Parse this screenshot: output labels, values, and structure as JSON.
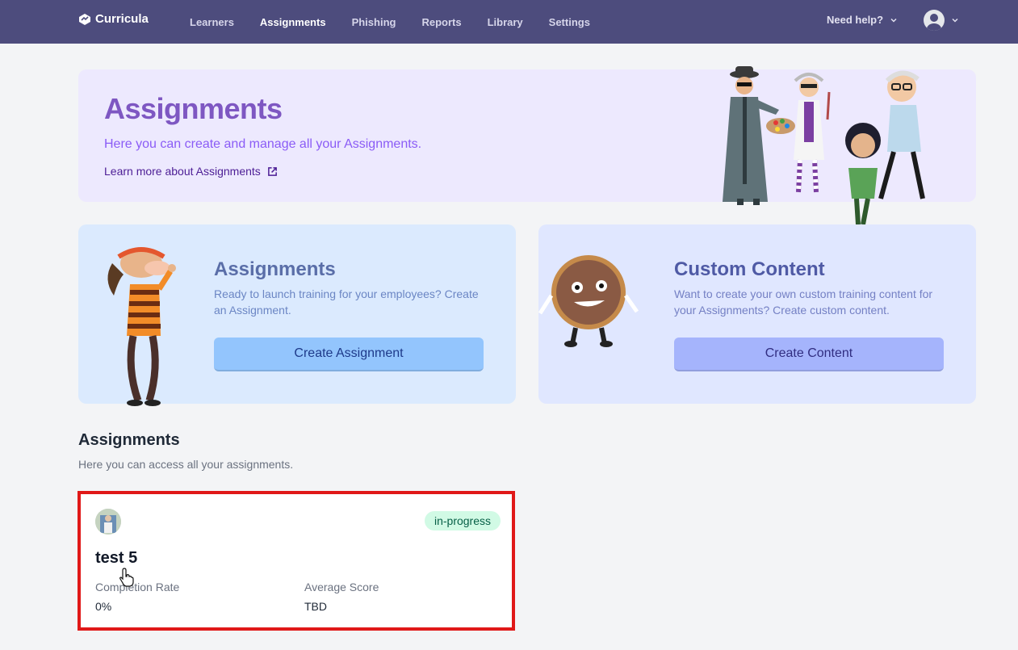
{
  "header": {
    "logo_text": "Curricula",
    "nav": [
      {
        "label": "Learners",
        "active": false
      },
      {
        "label": "Assignments",
        "active": true
      },
      {
        "label": "Phishing",
        "active": false
      },
      {
        "label": "Reports",
        "active": false
      },
      {
        "label": "Library",
        "active": false
      },
      {
        "label": "Settings",
        "active": false
      }
    ],
    "help_label": "Need help?",
    "brand_color": "#4d4c7d"
  },
  "hero": {
    "title": "Assignments",
    "subtitle": "Here you can create and manage all your Assignments.",
    "learn_more": "Learn more about Assignments"
  },
  "cards": {
    "assignments": {
      "title": "Assignments",
      "description": "Ready to launch training for your employees? Create an Assignment.",
      "button": "Create Assignment"
    },
    "custom": {
      "title": "Custom Content",
      "description": "Want to create your own custom training content for your Assignments? Create custom content.",
      "button": "Create Content"
    }
  },
  "list": {
    "title": "Assignments",
    "subtitle": "Here you can access all your assignments.",
    "items": [
      {
        "name": "test 5",
        "status": "in-progress",
        "completion_label": "Completion Rate",
        "completion_value": "0%",
        "score_label": "Average Score",
        "score_value": "TBD"
      }
    ]
  }
}
